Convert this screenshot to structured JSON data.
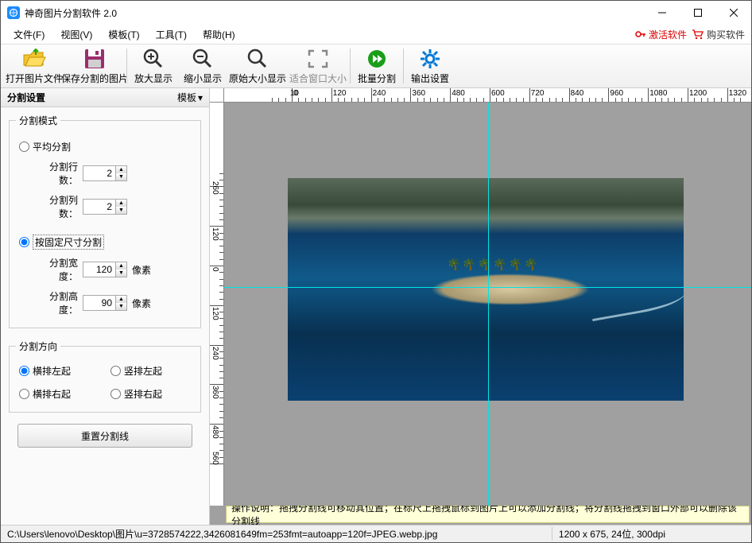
{
  "window": {
    "title": "神奇图片分割软件 2.0"
  },
  "menu": {
    "file": "文件(F)",
    "view": "视图(V)",
    "template": "模板(T)",
    "tools": "工具(T)",
    "help": "帮助(H)",
    "activate": "激活软件",
    "buy": "购买软件"
  },
  "toolbar": {
    "open": "打开图片文件",
    "save": "保存分割的图片",
    "zoomin": "放大显示",
    "zoomout": "缩小显示",
    "orig": "原始大小显示",
    "fit": "适合窗口大小",
    "batch": "批量分割",
    "output": "输出设置"
  },
  "panel": {
    "title": "分割设置",
    "template_btn": "模板",
    "mode_legend": "分割模式",
    "avg": "平均分割",
    "rows_label": "分割行数：",
    "cols_label": "分割列数：",
    "rows": "2",
    "cols": "2",
    "fixed": "按固定尺寸分割",
    "width_label": "分割宽度：",
    "height_label": "分割高度：",
    "width": "120",
    "height": "90",
    "px": "像素",
    "dir_legend": "分割方向",
    "h_l": "横排左起",
    "v_l": "竖排左起",
    "h_r": "横排右起",
    "v_r": "竖排右起",
    "reset": "重置分割线"
  },
  "hint": "操作说明：拖拽分割线可移动其位置；在标尺上拖拽鼠标到图片上可以添加分割线；将分割线拖拽到窗口外部可以删除该分割线",
  "status": {
    "path": "C:\\Users\\lenovo\\Desktop\\图片\\u=3728574222,3426081649fm=253fmt=autoapp=120f=JPEG.webp.jpg",
    "info": "1200 x 675, 24位, 300dpi"
  },
  "ruler_h": [
    -10,
    0,
    120,
    240,
    360,
    480,
    600,
    720,
    840,
    960,
    1080,
    1200,
    1320
  ],
  "ruler_v": [
    -260,
    -120,
    0,
    120,
    240,
    360,
    480,
    560
  ]
}
